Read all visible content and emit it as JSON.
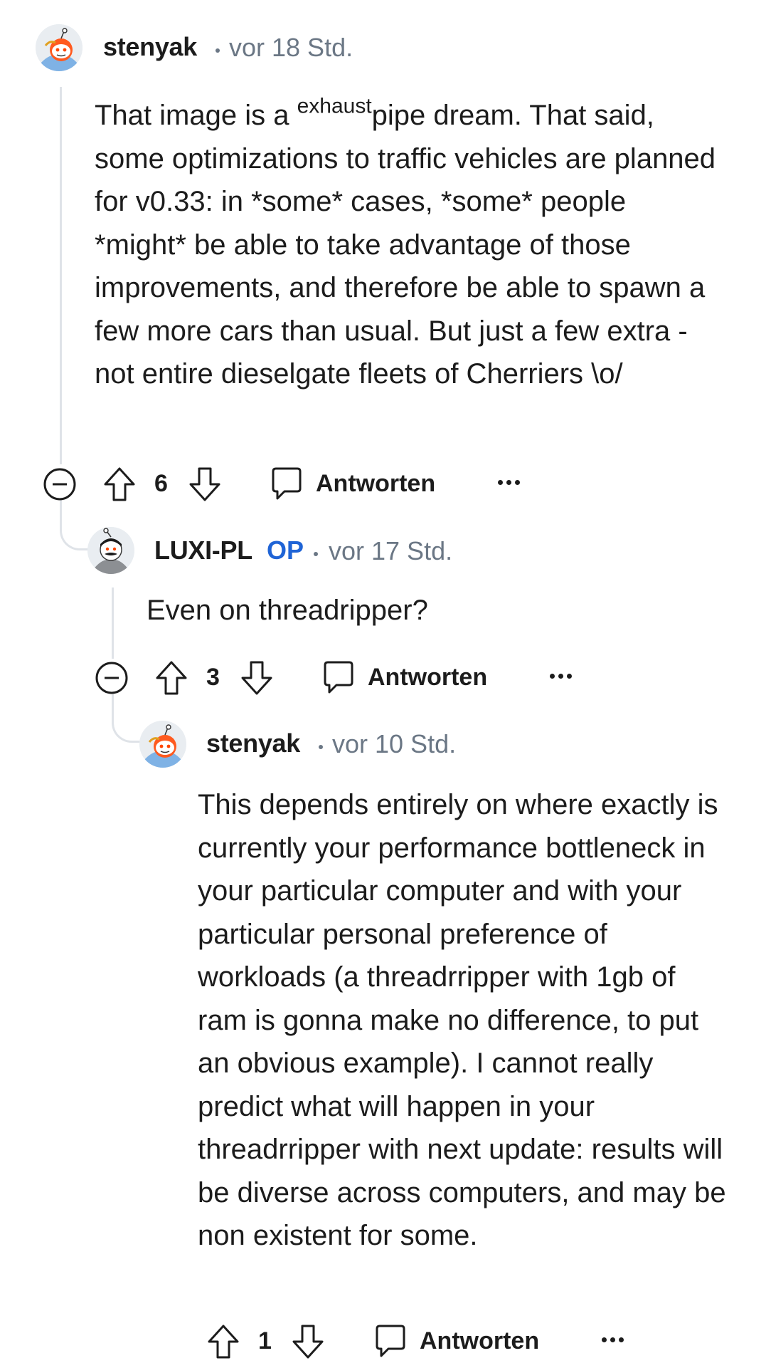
{
  "comments": [
    {
      "username": "stenyak",
      "timestamp": "vor 18 Std.",
      "body_prefix": "That image is a ",
      "body_sup": "exhaust",
      "body_rest": "pipe dream. That said, some optimizations to traffic vehicles are planned for v0.33: in *some* cases, *some* people *might* be able to take advantage of those improvements, and therefore be able to spawn a few more cars than usual. But just a few extra - not entire dieselgate fleets of Cherriers \\o/",
      "votes": "6",
      "reply_label": "Antworten"
    },
    {
      "username": "LUXI-PL",
      "op_badge": "OP",
      "timestamp": "vor 17 Std.",
      "body": "Even on threadripper?",
      "votes": "3",
      "reply_label": "Antworten"
    },
    {
      "username": "stenyak",
      "timestamp": "vor 10 Std.",
      "body": "This depends entirely on where exactly is currently your performance bottleneck in your particular computer and with your particular personal preference of workloads (a threadrripper with 1gb of ram is gonna make no difference, to put an obvious example). I cannot really predict what will happen in your threadrripper with next update: results will be diverse across computers, and may be non existent for some.",
      "votes": "1",
      "reply_label": "Antworten"
    }
  ],
  "icons": {
    "collapse": "minus-circle-icon",
    "upvote": "arrow-up-icon",
    "downvote": "arrow-down-icon",
    "reply": "speech-bubble-icon",
    "more": "ellipsis-icon"
  },
  "colors": {
    "op_badge": "#1f64d6",
    "muted": "#6b7785",
    "thread_line": "#dfe3e8"
  }
}
